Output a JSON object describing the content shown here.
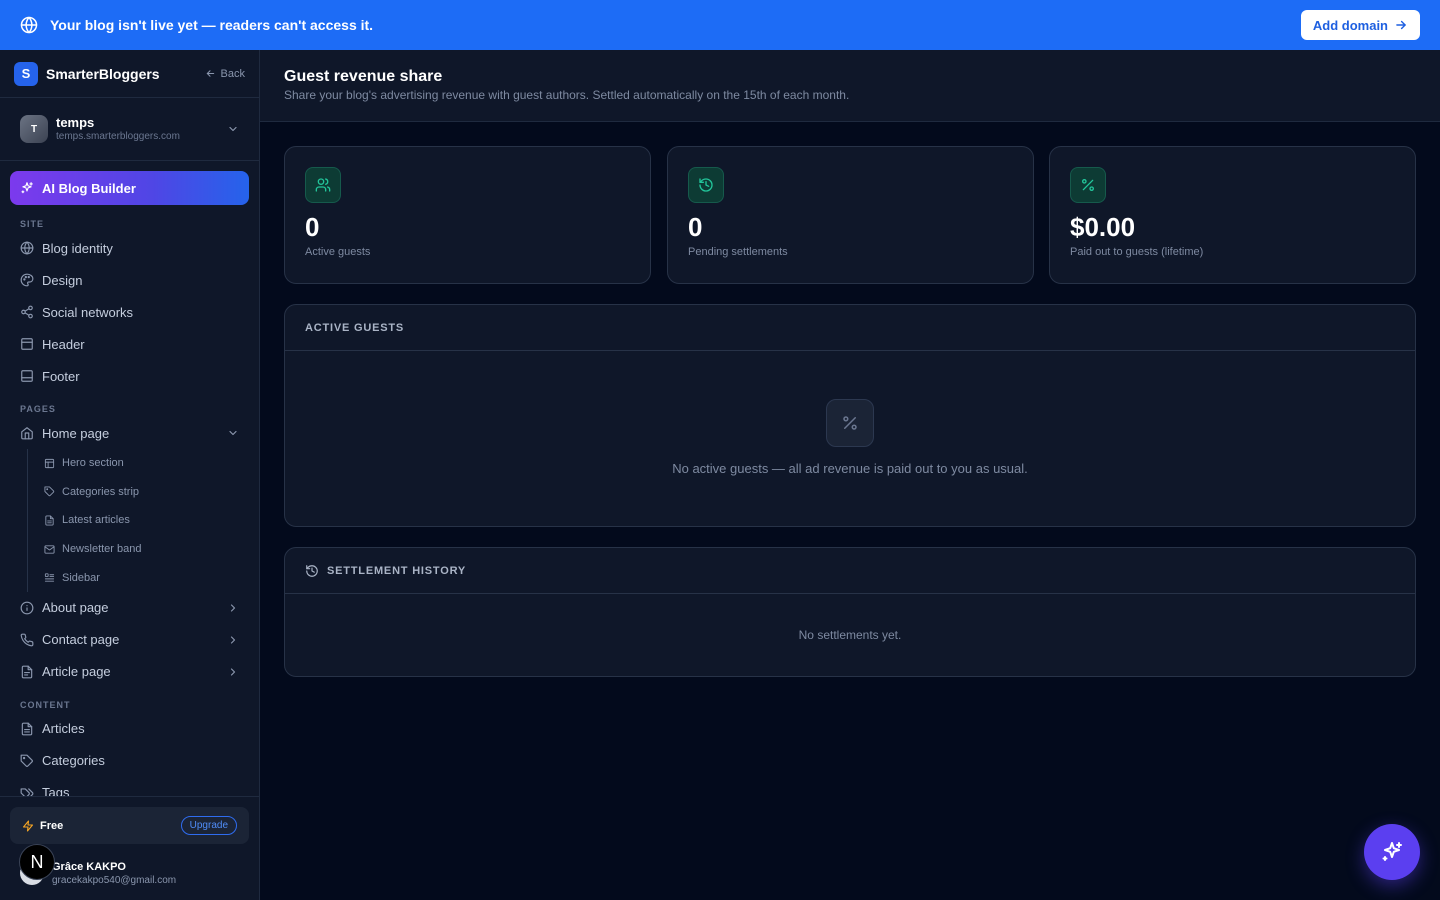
{
  "banner": {
    "message": "Your blog isn't live yet — readers can't access it.",
    "add_domain_label": "Add domain",
    "background": "#1d6cf6"
  },
  "sidebar": {
    "brand": {
      "logo_letter": "S",
      "name": "SmarterBloggers"
    },
    "back_label": "Back",
    "blog": {
      "avatar_letter": "T",
      "name": "temps",
      "url": "temps.smarterbloggers.com"
    },
    "ai_builder_label": "AI Blog Builder",
    "sections": {
      "site": "SITE",
      "pages": "PAGES",
      "content": "CONTENT"
    },
    "site_items": [
      {
        "label": "Blog identity",
        "icon": "globe-icon"
      },
      {
        "label": "Design",
        "icon": "palette-icon"
      },
      {
        "label": "Social networks",
        "icon": "share-icon"
      },
      {
        "label": "Header",
        "icon": "panel-top-icon"
      },
      {
        "label": "Footer",
        "icon": "panel-bottom-icon"
      }
    ],
    "home_page": {
      "label": "Home page",
      "sub_items": [
        {
          "label": "Hero section",
          "icon": "layout-icon"
        },
        {
          "label": "Categories strip",
          "icon": "tag-icon"
        },
        {
          "label": "Latest articles",
          "icon": "file-text-icon"
        },
        {
          "label": "Newsletter band",
          "icon": "mail-icon"
        },
        {
          "label": "Sidebar",
          "icon": "list-icon"
        }
      ]
    },
    "page_items": [
      {
        "label": "About page",
        "icon": "info-icon"
      },
      {
        "label": "Contact page",
        "icon": "phone-icon"
      },
      {
        "label": "Article page",
        "icon": "file-icon"
      }
    ],
    "content_items": [
      {
        "label": "Articles",
        "icon": "file-text-icon"
      },
      {
        "label": "Categories",
        "icon": "tag-icon"
      },
      {
        "label": "Tags",
        "icon": "tags-icon"
      }
    ],
    "plan": {
      "name": "Free",
      "upgrade_label": "Upgrade"
    },
    "user": {
      "name": "Grâce KAKPO",
      "email": "gracekakpo540@gmail.com",
      "badge_letter": "N"
    }
  },
  "header": {
    "title": "Guest revenue share",
    "subtitle": "Share your blog's advertising revenue with guest authors. Settled automatically on the 15th of each month."
  },
  "stats": [
    {
      "value": "0",
      "label": "Active guests",
      "icon": "users-icon"
    },
    {
      "value": "0",
      "label": "Pending settlements",
      "icon": "history-icon"
    },
    {
      "value": "$0.00",
      "label": "Paid out to guests (lifetime)",
      "icon": "percent-icon"
    }
  ],
  "active_guests": {
    "title": "ACTIVE GUESTS",
    "empty_text": "No active guests — all ad revenue is paid out to you as usual."
  },
  "settlement_history": {
    "title": "SETTLEMENT HISTORY",
    "empty_text": "No settlements yet."
  },
  "colors": {
    "accent": "#2563eb",
    "success_icon": "#22c59a",
    "fab": "#5b3ff0"
  }
}
